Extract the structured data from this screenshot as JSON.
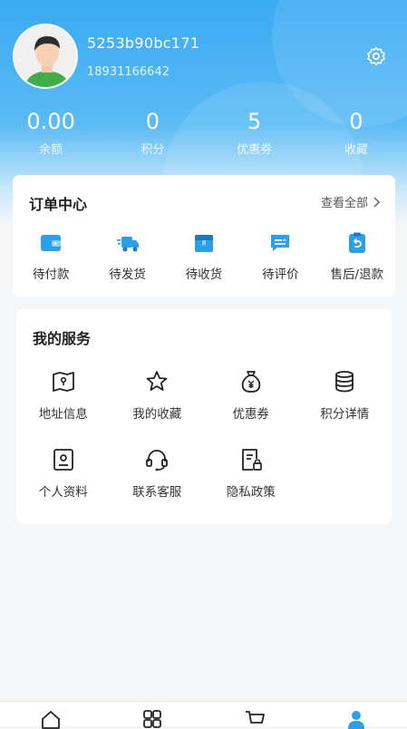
{
  "profile": {
    "username": "5253b90bc171",
    "phone": "18931166642"
  },
  "stats": [
    {
      "value": "0.00",
      "label": "余额"
    },
    {
      "value": "0",
      "label": "积分"
    },
    {
      "value": "5",
      "label": "优惠券"
    },
    {
      "value": "0",
      "label": "收藏"
    }
  ],
  "orders": {
    "title": "订单中心",
    "view_all": "查看全部",
    "items": [
      {
        "label": "待付款",
        "icon": "wallet-icon"
      },
      {
        "label": "待发货",
        "icon": "delivery-truck-icon"
      },
      {
        "label": "待收货",
        "icon": "package-icon"
      },
      {
        "label": "待评价",
        "icon": "review-icon"
      },
      {
        "label": "售后/退款",
        "icon": "refund-icon"
      }
    ]
  },
  "services": {
    "title": "我的服务",
    "items": [
      {
        "label": "地址信息",
        "icon": "map-icon"
      },
      {
        "label": "我的收藏",
        "icon": "star-icon"
      },
      {
        "label": "优惠券",
        "icon": "money-bag-icon"
      },
      {
        "label": "积分详情",
        "icon": "coins-icon"
      },
      {
        "label": "个人资料",
        "icon": "profile-card-icon"
      },
      {
        "label": "联系客服",
        "icon": "headset-icon"
      },
      {
        "label": "隐私政策",
        "icon": "privacy-doc-icon"
      }
    ]
  },
  "colors": {
    "accent": "#2b9fea",
    "header_top": "#3aaaf2",
    "background": "#f5f6f8"
  },
  "tabbar": {
    "items": [
      {
        "icon": "home-icon"
      },
      {
        "icon": "category-icon"
      },
      {
        "icon": "cart-icon"
      },
      {
        "icon": "user-icon",
        "active": true
      }
    ]
  }
}
